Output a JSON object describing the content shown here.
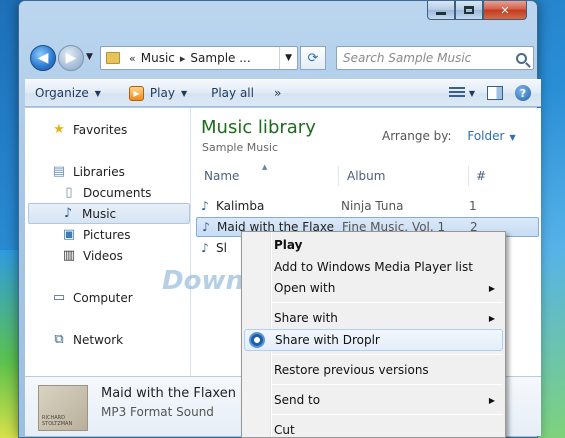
{
  "address": {
    "crumbs": [
      "Music",
      "Sample ..."
    ],
    "chevrons": "«"
  },
  "search": {
    "placeholder": "Search Sample Music"
  },
  "toolbar": {
    "organize": "Organize",
    "play": "Play",
    "play_all": "Play all",
    "more": "»"
  },
  "nav": {
    "favorites": "Favorites",
    "libraries": "Libraries",
    "documents": "Documents",
    "music": "Music",
    "pictures": "Pictures",
    "videos": "Videos",
    "computer": "Computer",
    "network": "Network"
  },
  "library": {
    "title": "Music library",
    "subtitle": "Sample Music",
    "arrange_label": "Arrange by:",
    "arrange_value": "Folder"
  },
  "columns": {
    "name": "Name",
    "album": "Album",
    "num": "#"
  },
  "files": [
    {
      "name": "Kalimba",
      "album": "Ninja Tuna",
      "num": "1"
    },
    {
      "name": "Maid with the Flaxe",
      "album": "Fine Music, Vol. 1",
      "num": "2"
    },
    {
      "name": "Sl",
      "album": "",
      "num": ""
    }
  ],
  "details": {
    "title": "Maid with the Flaxen H",
    "type": "MP3 Format Sound",
    "thumb_text": "RICHARD STOLTZMAN"
  },
  "context_menu": {
    "play": "Play",
    "add_to_list": "Add to Windows Media Player list",
    "open_with": "Open with",
    "share_with": "Share with",
    "share_droplr": "Share with Droplr",
    "restore": "Restore previous versions",
    "send_to": "Send to",
    "cut": "Cut"
  },
  "watermark": {
    "text": "Download.com.vn",
    "dot_colors": [
      "#4aa3df",
      "#8ed0f0",
      "#f5c542",
      "#f08a3c",
      "#3b8fd0",
      "#e0554a"
    ]
  }
}
